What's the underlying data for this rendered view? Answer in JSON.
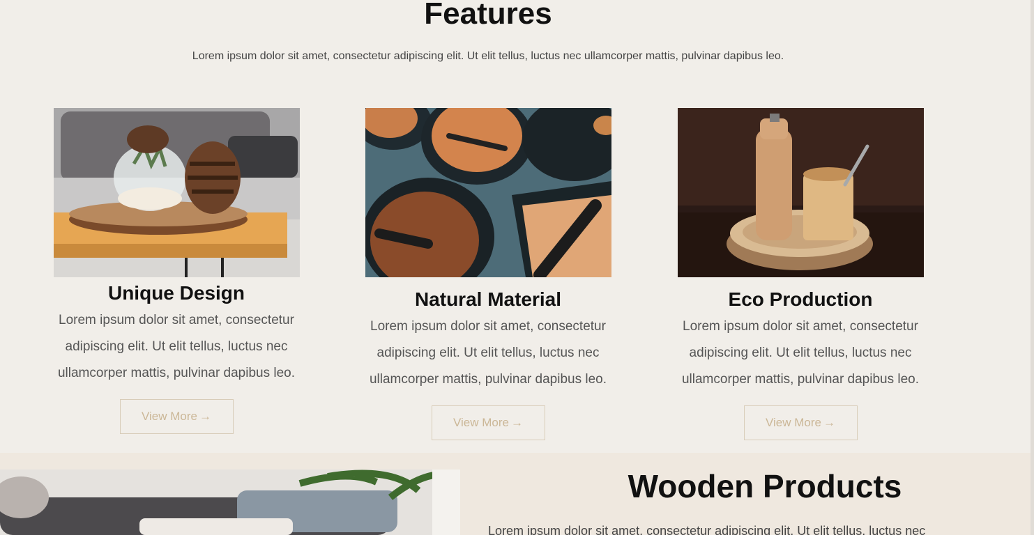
{
  "features": {
    "title": "Features",
    "subtitle": "Lorem ipsum dolor sit amet, consectetur adipiscing elit. Ut elit tellus, luctus nec ullamcorper mattis, pulvinar dapibus leo."
  },
  "cards": [
    {
      "title": "Unique Design",
      "text": "Lorem ipsum dolor sit amet, consectetur adipiscing elit. Ut elit tellus, luctus nec ullamcorper mattis, pulvinar dapibus leo.",
      "button": "View More",
      "icon": "arrow-right-icon"
    },
    {
      "title": "Natural Material",
      "text": "Lorem ipsum dolor sit amet, consectetur adipiscing elit. Ut elit tellus, luctus nec ullamcorper mattis, pulvinar dapibus leo.",
      "button": "View More",
      "icon": "arrow-right-icon"
    },
    {
      "title": "Eco Production",
      "text": "Lorem ipsum dolor sit amet, consectetur adipiscing elit. Ut elit tellus, luctus nec ullamcorper mattis, pulvinar dapibus leo.",
      "button": "View More",
      "icon": "arrow-right-icon"
    }
  ],
  "products": {
    "title": "Wooden Products",
    "text": "Lorem ipsum dolor sit amet, consectetur adipiscing elit. Ut elit tellus, luctus nec"
  },
  "colors": {
    "background": "#f1eee9",
    "band": "#efe8df",
    "accent": "#cbb797"
  }
}
